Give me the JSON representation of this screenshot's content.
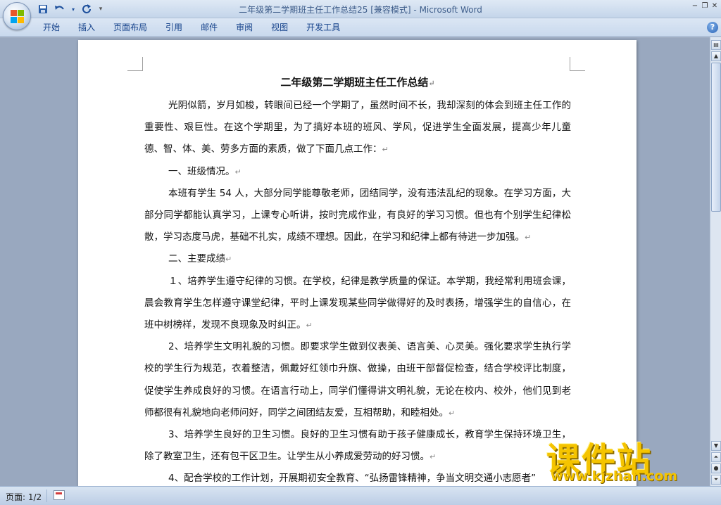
{
  "window": {
    "doc_name": "二年级第二学期班主任工作总结25 [兼容模式]",
    "separator": " - ",
    "app_name": "Microsoft Word",
    "controls": [
      "−",
      "❐",
      "✕"
    ]
  },
  "qat": {
    "save_icon": "💾",
    "undo_icon": "↶",
    "redo_icon": "↻",
    "more_icon": "▾"
  },
  "ribbon": {
    "tabs": [
      "开始",
      "插入",
      "页面布局",
      "引用",
      "邮件",
      "审阅",
      "视图",
      "开发工具"
    ],
    "help": "?"
  },
  "document": {
    "title": "二年级第二学期班主任工作总结",
    "paragraphs": [
      "光阴似箭，岁月如梭，转眼间已经一个学期了，虽然时间不长，我却深刻的体会到班主任工作的重要性、艰巨性。在这个学期里，为了搞好本班的班风、学风，促进学生全面发展，提高少年儿童德、智、体、美、劳多方面的素质，做了下面几点工作：",
      "一、班级情况。",
      "本班有学生 54 人，大部分同学能尊敬老师，团结同学，没有违法乱纪的现象。在学习方面，大部分同学都能认真学习，上课专心听讲，按时完成作业，有良好的学习习惯。但也有个别学生纪律松散，学习态度马虎，基础不扎实，成绩不理想。因此，在学习和纪律上都有待进一步加强。",
      "二、主要成绩",
      "１、培养学生遵守纪律的习惯。在学校，纪律是教学质量的保证。本学期，我经常利用班会课，晨会教育学生怎样遵守课堂纪律，平时上课发现某些同学做得好的及时表扬，增强学生的自信心，在班中树榜样，发现不良现象及时纠正。",
      "2、培养学生文明礼貌的习惯。即要求学生做到仪表美、语言美、心灵美。强化要求学生执行学校的学生行为规范，衣着整洁，佩戴好红领巾升旗、做操，由班干部督促检查，结合学校评比制度，促使学生养成良好的习惯。在语言行动上，同学们懂得讲文明礼貌，无论在校内、校外，他们见到老师都很有礼貌地向老师问好，同学之间团结友爱，互相帮助，和睦相处。",
      "3、培养学生良好的卫生习惯。良好的卫生习惯有助于孩子健康成长，教育学生保持环境卫生，除了教室卫生，还有包干区卫生。让学生从小养成爱劳动的好习惯。",
      "4、配合学校的工作计划，开展期初安全教育、“弘扬雷锋精神，争当文明交通小志愿者”"
    ],
    "paragraph_mark": "↵"
  },
  "watermark": {
    "title": "课件站",
    "url": "www.kjzhan.com"
  },
  "statusbar": {
    "page_count": "页面: 1/2"
  },
  "colors": {
    "title_text": "#3e5d8a",
    "ribbon_tab_text": "#15428b",
    "watermark": "#f5c400"
  }
}
